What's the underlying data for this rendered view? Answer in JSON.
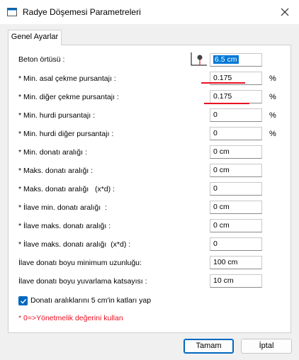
{
  "window": {
    "title": "Radye Döşemesi Parametreleri"
  },
  "tabs": [
    {
      "label": "Genel Ayarlar"
    }
  ],
  "fields": [
    {
      "label": "Beton örtüsü :",
      "value": "6.5 cm",
      "unit": ""
    },
    {
      "label": "* Min. asal çekme pursantajı :",
      "value": "0.175",
      "unit": "%"
    },
    {
      "label": "* Min. diğer çekme pursantajı :",
      "value": "0.175",
      "unit": "%"
    },
    {
      "label": "* Min. hurdi pursantajı :",
      "value": "0",
      "unit": "%"
    },
    {
      "label": "* Min. hurdi diğer pursantajı :",
      "value": "0",
      "unit": "%"
    },
    {
      "label": "* Min. donatı aralığı :",
      "value": "0 cm",
      "unit": ""
    },
    {
      "label": "* Maks. donatı aralığı :",
      "value": "0 cm",
      "unit": ""
    },
    {
      "label": "* Maks. donatı aralığı   (x*d) :",
      "value": "0",
      "unit": ""
    },
    {
      "label": "* İlave min. donatı aralığı  :",
      "value": "0 cm",
      "unit": ""
    },
    {
      "label": "* İlave maks. donatı aralığı :",
      "value": "0 cm",
      "unit": ""
    },
    {
      "label": "* İlave maks. donatı aralığı  (x*d) :",
      "value": "0",
      "unit": ""
    },
    {
      "label": "İlave donatı boyu minimum uzunluğu:",
      "value": "100 cm",
      "unit": ""
    },
    {
      "label": "İlave donatı boyu yuvarlama katsayısı :",
      "value": "10 cm",
      "unit": ""
    }
  ],
  "checkbox": {
    "label": "Donatı aralıklarını 5 cm'in katları yap",
    "checked": true
  },
  "note": "* 0=>Yönetmelik değerini kullan",
  "buttons": {
    "ok": "Tamam",
    "cancel": "İptal"
  },
  "colors": {
    "accent": "#0067c0",
    "highlight": "#e81123"
  }
}
